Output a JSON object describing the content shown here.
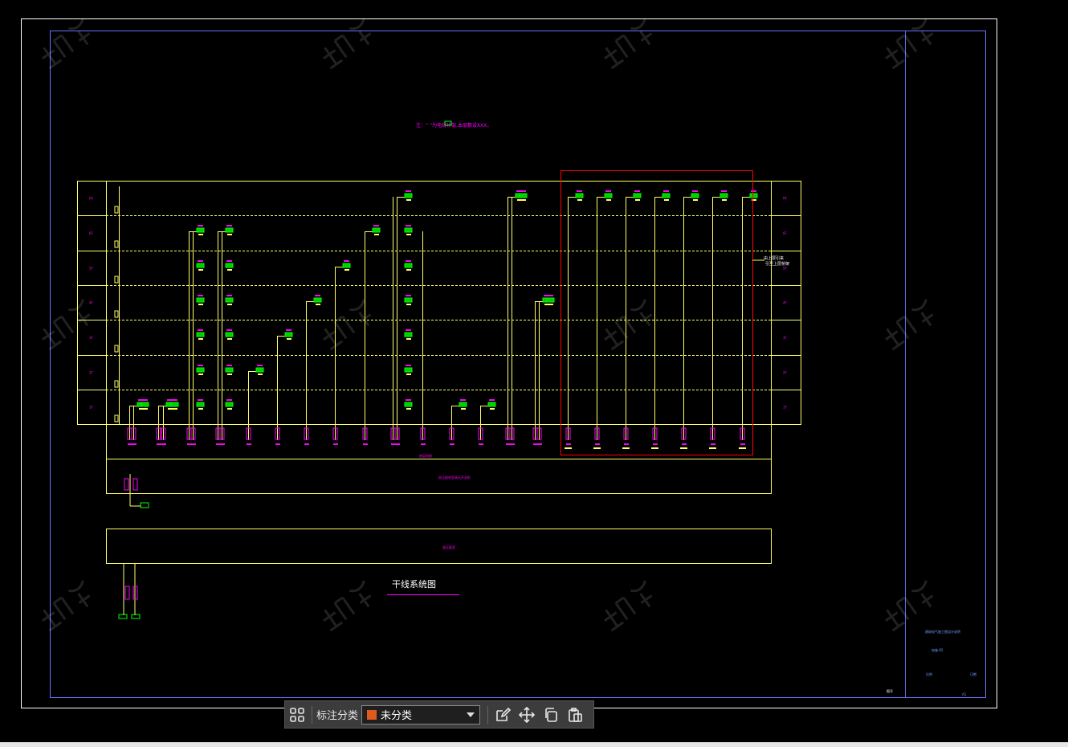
{
  "drawing": {
    "title": "干线系统图",
    "top_note": "注：“  ”为电缆桥架,本层敷设XXX。",
    "bus_label": "底层电缆",
    "box1_label": "低压配电室高压开关柜",
    "box2_label": "变压器室",
    "right_note_1": "由上层引来",
    "right_note_2": "引至上层桥架",
    "floors_left": [
      "RF",
      "6F",
      "5F",
      "4F",
      "3F",
      "2F",
      "1F"
    ],
    "floors_right": [
      "RF",
      "6F",
      "5F",
      "4F",
      "3F",
      "2F",
      "1F"
    ],
    "branch_label": "AL-1",
    "tb_lines": [
      "建筑电气施工图设计说明",
      "电施-05",
      "比例",
      "日期"
    ],
    "tb_corner": "图号",
    "sheet_mark": "A1",
    "accent_colors": {
      "yellow": "#ffff66",
      "magenta": "#ff00ff",
      "green": "#00ff00",
      "red": "#ff0000",
      "blue": "#6f6fff"
    }
  },
  "toolbar": {
    "label": "标注分类",
    "category_value": "未分类",
    "category_color": "#e05a1f",
    "icons": [
      "grid-icon",
      "edit-icon",
      "move-icon",
      "copy-icon",
      "paste-icon"
    ]
  }
}
